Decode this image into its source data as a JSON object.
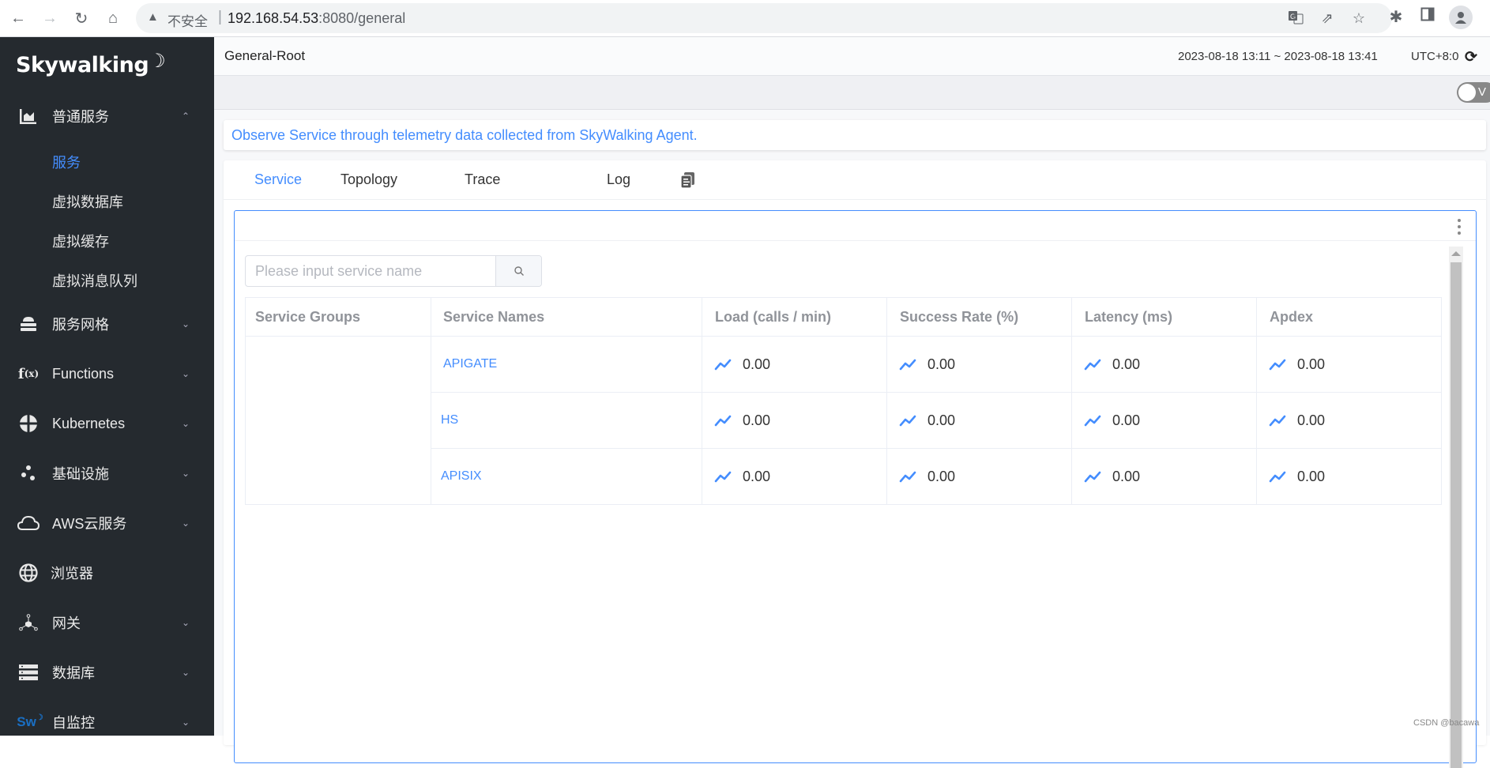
{
  "browser": {
    "security_label": "不安全",
    "url_host": "192.168.54.53",
    "url_path": ":8080/general",
    "icons": [
      "back-icon",
      "forward-icon",
      "reload-icon",
      "home-icon",
      "translate-icon",
      "share-icon",
      "bookmark-star-icon",
      "extensions-icon",
      "side-panel-icon",
      "profile-icon"
    ]
  },
  "sidebar": {
    "logo": "Skywalking",
    "items": [
      {
        "label": "普通服务",
        "icon": "chart-area-icon",
        "expanded": true,
        "children": [
          {
            "label": "服务",
            "active": true
          },
          {
            "label": "虚拟数据库"
          },
          {
            "label": "虚拟缓存"
          },
          {
            "label": "虚拟消息队列"
          }
        ]
      },
      {
        "label": "服务网格",
        "icon": "mesh-stack-icon"
      },
      {
        "label": "Functions",
        "icon": "function-icon"
      },
      {
        "label": "Kubernetes",
        "icon": "kubernetes-icon"
      },
      {
        "label": "基础设施",
        "icon": "infrastructure-dots-icon"
      },
      {
        "label": "AWS云服务",
        "icon": "cloud-icon"
      },
      {
        "label": "浏览器",
        "icon": "globe-icon"
      },
      {
        "label": "网关",
        "icon": "gateway-icon"
      },
      {
        "label": "数据库",
        "icon": "database-icon"
      },
      {
        "label": "自监控",
        "icon": "sw-self-observability-icon"
      }
    ]
  },
  "header": {
    "title": "General-Root",
    "time_range": "2023-08-18 13:11 ~ 2023-08-18 13:41",
    "timezone": "UTC+8:0",
    "toggle_label": "V"
  },
  "description": "Observe Service through telemetry data collected from SkyWalking Agent.",
  "tabs": [
    {
      "label": "Service",
      "active": true
    },
    {
      "label": "Topology"
    },
    {
      "label": "Trace"
    },
    {
      "label": "Log"
    }
  ],
  "search": {
    "placeholder": "Please input service name",
    "value": ""
  },
  "table": {
    "columns": [
      "Service Groups",
      "Service Names",
      "Load (calls / min)",
      "Success Rate (%)",
      "Latency (ms)",
      "Apdex"
    ],
    "rows": [
      {
        "group": "",
        "name": "APIGATE",
        "load": "0.00",
        "success_rate": "0.00",
        "latency": "0.00",
        "apdex": "0.00"
      },
      {
        "group": "",
        "name": "HS",
        "load": "0.00",
        "success_rate": "0.00",
        "latency": "0.00",
        "apdex": "0.00"
      },
      {
        "group": "",
        "name": "APISIX",
        "load": "0.00",
        "success_rate": "0.00",
        "latency": "0.00",
        "apdex": "0.00"
      }
    ]
  },
  "colors": {
    "accent": "#448dfe",
    "sidebar_bg": "#252a2f",
    "trend_icon": "#448dfe"
  },
  "watermark": "CSDN @bacawa"
}
